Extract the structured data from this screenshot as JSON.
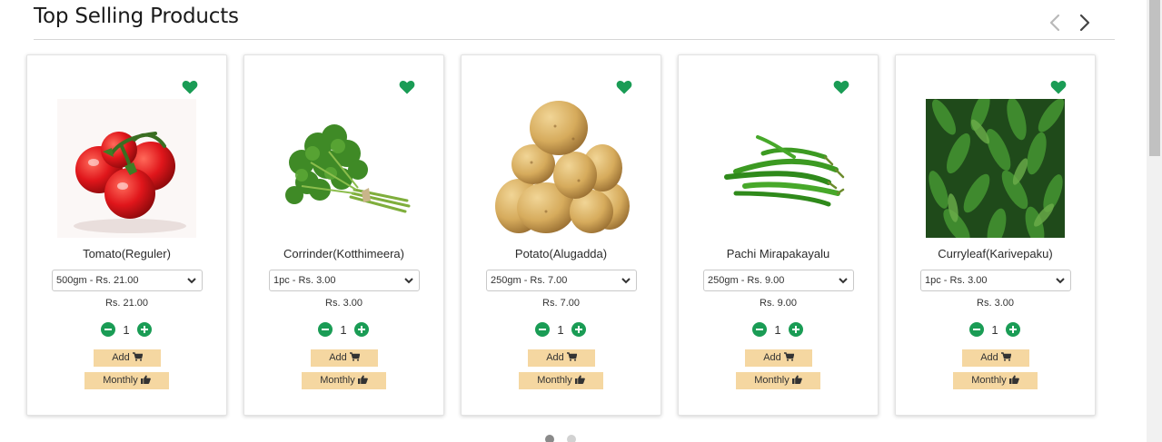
{
  "section": {
    "title": "Top Selling Products"
  },
  "colors": {
    "accent_green": "#1a9c55",
    "button_bg": "#f5d7a1",
    "dot_active": "#8a8a8a",
    "dot_inactive": "#d2d2d2"
  },
  "carousel": {
    "prev_icon": "chevron-left-icon",
    "next_icon": "chevron-right-icon",
    "page_count": 2,
    "active_page": 1
  },
  "products": [
    {
      "name": "Tomato(Reguler)",
      "variant": "500gm - Rs. 21.00",
      "price": "Rs. 21.00",
      "qty": "1",
      "add_label": "Add",
      "monthly_label": "Monthly",
      "image": "tomato"
    },
    {
      "name": "Corrinder(Kotthimeera)",
      "variant": "1pc - Rs. 3.00",
      "price": "Rs. 3.00",
      "qty": "1",
      "add_label": "Add",
      "monthly_label": "Monthly",
      "image": "coriander"
    },
    {
      "name": "Potato(Alugadda)",
      "variant": "250gm - Rs. 7.00",
      "price": "Rs. 7.00",
      "qty": "1",
      "add_label": "Add",
      "monthly_label": "Monthly",
      "image": "potato"
    },
    {
      "name": "Pachi Mirapakayalu",
      "variant": "250gm - Rs. 9.00",
      "price": "Rs. 9.00",
      "qty": "1",
      "add_label": "Add",
      "monthly_label": "Monthly",
      "image": "green-chilli"
    },
    {
      "name": "Curryleaf(Karivepaku)",
      "variant": "1pc - Rs. 3.00",
      "price": "Rs. 3.00",
      "qty": "1",
      "add_label": "Add",
      "monthly_label": "Monthly",
      "image": "curry-leaf"
    }
  ]
}
